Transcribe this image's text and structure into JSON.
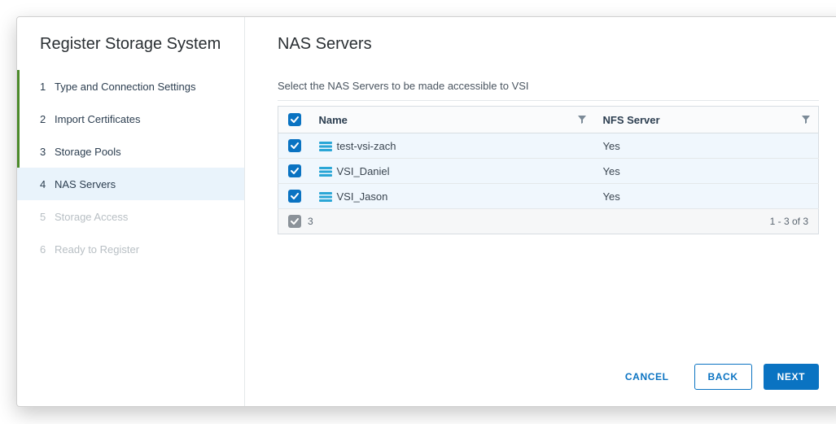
{
  "sidebar": {
    "title": "Register Storage System",
    "steps": [
      {
        "label": "Type and Connection Settings",
        "state": "completed"
      },
      {
        "label": "Import Certificates",
        "state": "completed"
      },
      {
        "label": "Storage Pools",
        "state": "completed"
      },
      {
        "label": "NAS Servers",
        "state": "active"
      },
      {
        "label": "Storage Access",
        "state": "disabled"
      },
      {
        "label": "Ready to Register",
        "state": "disabled"
      }
    ]
  },
  "page": {
    "title": "NAS Servers",
    "description": "Select the NAS Servers to be made accessible to VSI"
  },
  "table": {
    "columns": {
      "name": "Name",
      "nfs": "NFS Server"
    },
    "rows": [
      {
        "name": "test-vsi-zach",
        "nfs": "Yes",
        "checked": true
      },
      {
        "name": "VSI_Daniel",
        "nfs": "Yes",
        "checked": true
      },
      {
        "name": "VSI_Jason",
        "nfs": "Yes",
        "checked": true
      }
    ],
    "footer": {
      "selected_count": "3",
      "range": "1 - 3 of 3"
    }
  },
  "actions": {
    "cancel": "CANCEL",
    "back": "BACK",
    "next": "NEXT"
  }
}
